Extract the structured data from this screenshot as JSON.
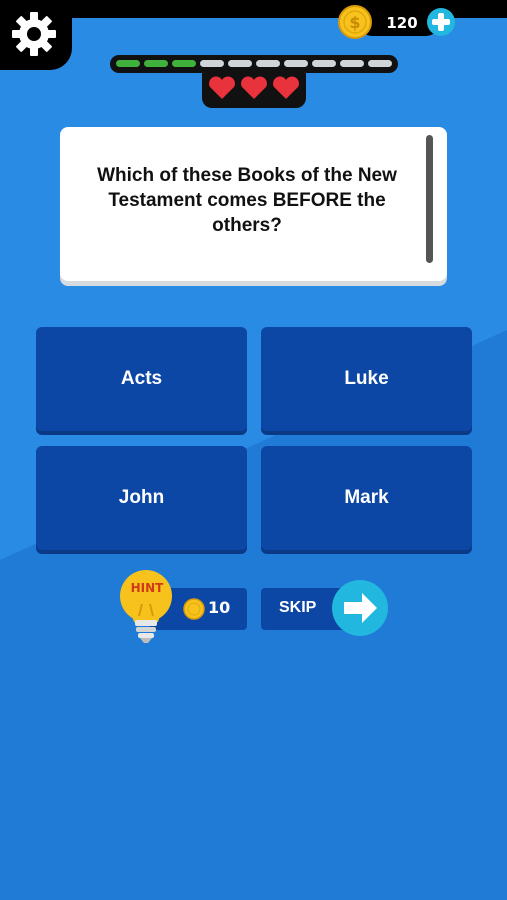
{
  "header": {
    "coins": "120"
  },
  "progress": {
    "total_segments": 10,
    "completed_segments": 3
  },
  "lives": {
    "hearts": 3
  },
  "question": {
    "text": "Which of these Books of the New Testament comes BEFORE the others?"
  },
  "answers": [
    {
      "label": "Acts"
    },
    {
      "label": "Luke"
    },
    {
      "label": "John"
    },
    {
      "label": "Mark"
    }
  ],
  "hint": {
    "label": "HINT",
    "cost": "10"
  },
  "skip": {
    "label": "SKIP"
  },
  "colors": {
    "background": "#2a8be5",
    "answer_tile": "#0d47a6",
    "progress_done": "#3fb13c",
    "heart": "#e8323c",
    "coin": "#f6c21b",
    "accent": "#22b7df"
  }
}
